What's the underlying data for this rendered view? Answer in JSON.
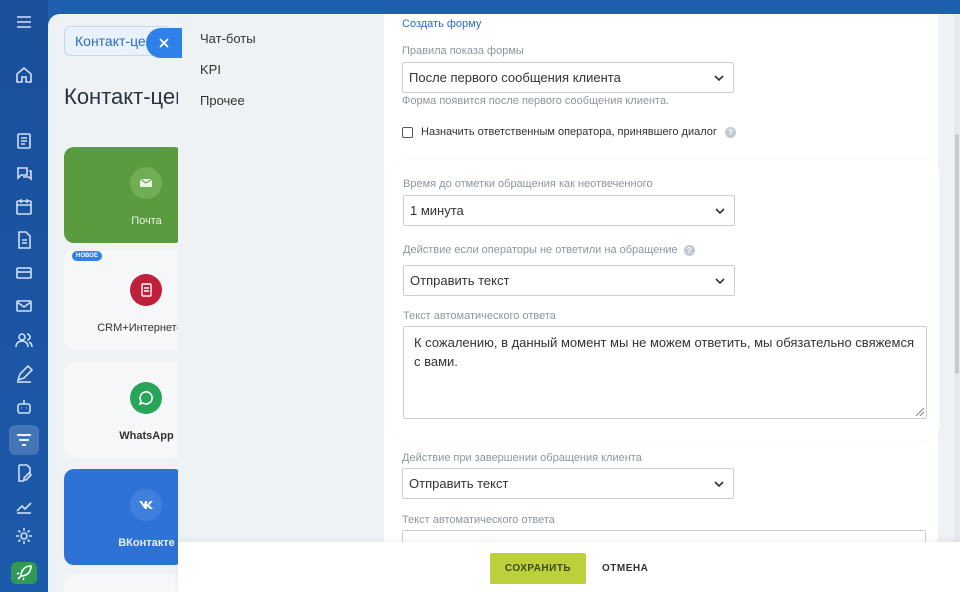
{
  "background": {
    "breadcrumb": "Контакт-цент",
    "title": "Контакт-цен",
    "tiles": {
      "mail": "Почта",
      "crm": "CRM+Интернет-Ма",
      "whatsapp": "WhatsApp",
      "vk": "ВКонтакте"
    },
    "new_badge": "НОВОЕ",
    "icons": [
      "menu-icon",
      "home-icon",
      "tasks-icon",
      "chat-icon",
      "calendar-icon",
      "document-icon",
      "card-icon",
      "mail-icon",
      "users-icon",
      "pen-icon",
      "robot-icon",
      "filter-icon",
      "edit-doc-icon",
      "chart-icon",
      "gear-icon",
      "rocket-icon"
    ]
  },
  "nav": {
    "items": [
      "Чат-боты",
      "KPI",
      "Прочее"
    ]
  },
  "form": {
    "create_form_link": "Создать форму",
    "rules_label": "Правила показа формы",
    "rules_value": "После первого сообщения клиента",
    "rules_hint": "Форма появится после первого сообщения клиента.",
    "assign_checkbox_label": "Назначить ответственным оператора, принявшего диалог",
    "unanswered_time_label": "Время до отметки обращения как неотвеченного",
    "unanswered_time_value": "1 минута",
    "no_answer_action_label": "Действие если операторы не ответили на обращение",
    "no_answer_action_value": "Отправить текст",
    "auto_reply_label": "Текст автоматического ответа",
    "auto_reply_text": "К сожалению, в данный момент мы не можем ответить, мы обязательно свяжемся с вами.",
    "finish_action_label": "Действие при завершении обращения клиента",
    "finish_action_value": "Отправить текст",
    "auto_reply_label_2": "Текст автоматического ответа",
    "qmark": "?"
  },
  "footer": {
    "save_label": "СОХРАНИТЬ",
    "cancel_label": "ОТМЕНА"
  },
  "colors": {
    "accent": "#2f80e8",
    "save": "#bbd03a",
    "sidebar": "#1b4f9a"
  }
}
